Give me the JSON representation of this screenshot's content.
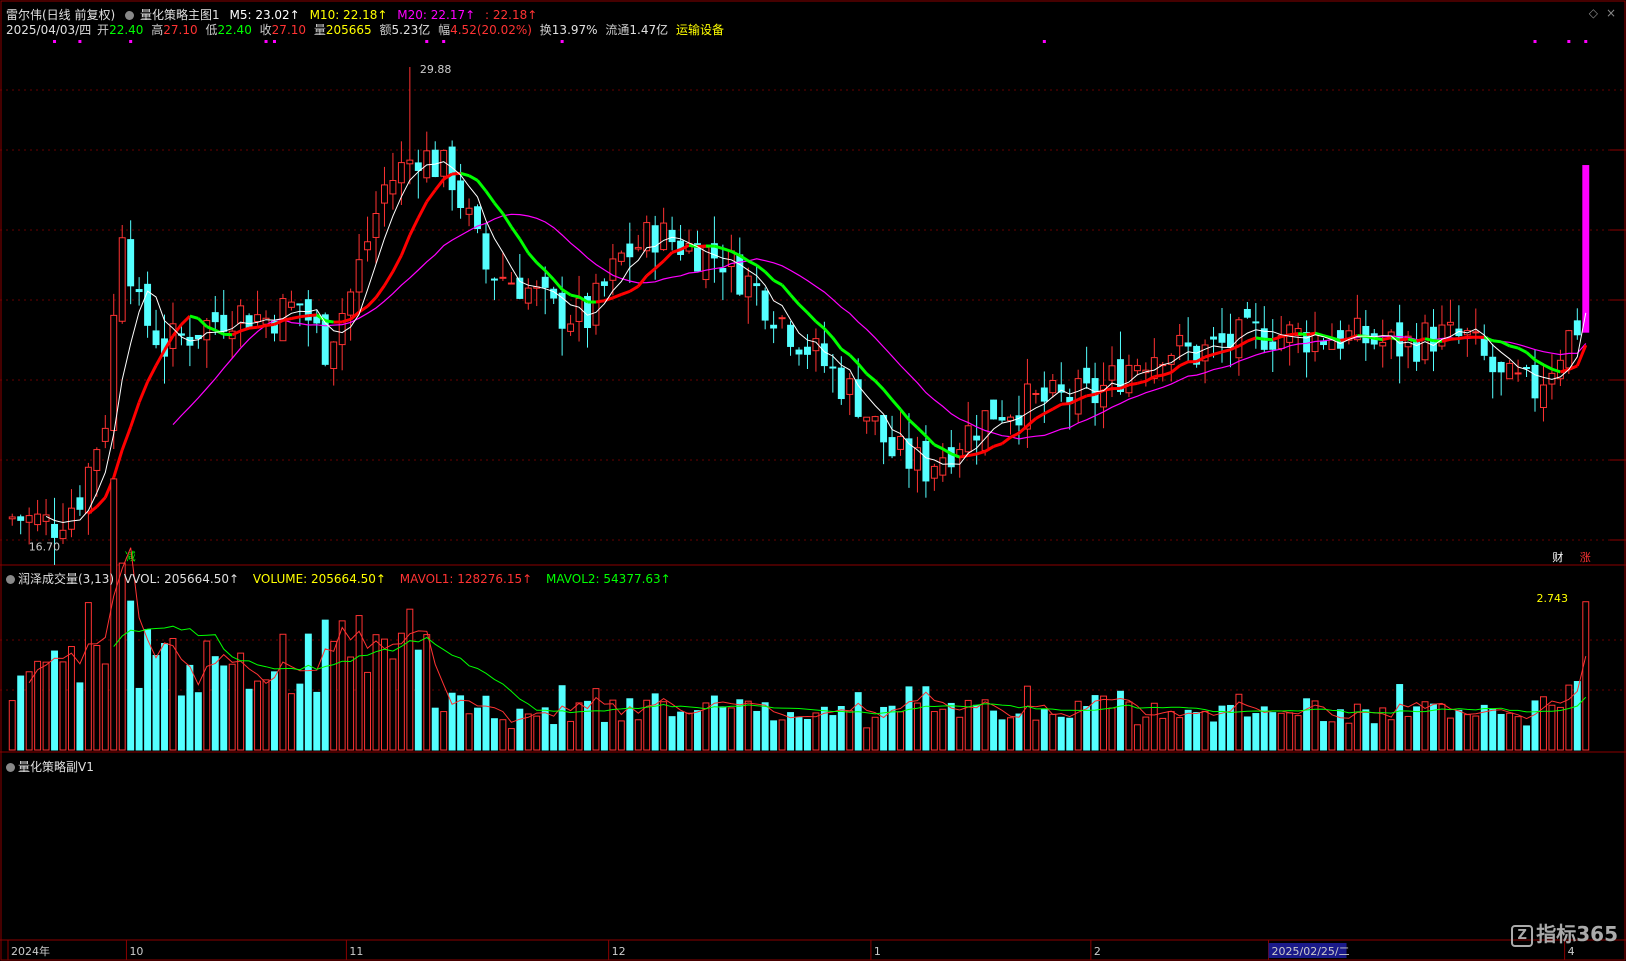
{
  "header": {
    "stock": "雷尔伟(日线 前复权)",
    "indicator_name": "量化策略主图1",
    "m5": "M5: 23.02↑",
    "m10": "M10: 22.18↑",
    "m20": "M20: 22.17↑",
    "extra": ": 22.18↑",
    "date": "2025/04/03/四",
    "open_label": "开",
    "open": "22.40",
    "high_label": "高",
    "high": "27.10",
    "low_label": "低",
    "low": "22.40",
    "close_label": "收",
    "close": "27.10",
    "vol_label": "量",
    "vol": "205665",
    "amount_label": "额",
    "amount": "5.23亿",
    "change_label": "幅",
    "change": "4.52(20.02%)",
    "turnover_label": "换",
    "turnover": "13.97%",
    "float_label": "流通",
    "float": "1.47亿",
    "sector": "运输设备"
  },
  "volume_panel": {
    "name": "润泽成交量(3,13)",
    "vvol": "VVOL: 205664.50↑",
    "volume": "VOLUME: 205664.50↑",
    "mavol1": "MAVOL1: 128276.15↑",
    "mavol2": "MAVOL2: 54377.63↑",
    "max_label": "2.743"
  },
  "sub_panel": {
    "name": "量化策略副V1"
  },
  "markers": {
    "low_price": "16.70",
    "high_price": "29.88",
    "sell": "减",
    "fin": "财",
    "up": "涨"
  },
  "x_axis": {
    "labels": [
      {
        "text": "2024年",
        "index": 0
      },
      {
        "text": "10",
        "index": 14
      },
      {
        "text": "11",
        "index": 40
      },
      {
        "text": "12",
        "index": 71
      },
      {
        "text": "1",
        "index": 102
      },
      {
        "text": "2",
        "index": 128
      },
      {
        "text": "2025/02/25/二",
        "index": 149
      },
      {
        "text": "4",
        "index": 184
      }
    ]
  },
  "logo": {
    "text": "指标365",
    "icon": "z-logo-icon"
  },
  "colors": {
    "up": "#ff3232",
    "down": "#54ffff",
    "ma5": "#ffffff",
    "ma10_up": "#ff0000",
    "ma10_down": "#00ff00",
    "ma20": "#ff00ff",
    "grid": "#8b0000",
    "magenta": "#ff00ff",
    "vol_ma1": "#ff3333",
    "vol_ma2": "#00ff00"
  },
  "chart_data": {
    "type": "candlestick",
    "price_range": [
      16.2,
      30.5
    ],
    "ohlc_seed": "generated series approximating visible trend",
    "key_prices": {
      "min": 16.7,
      "max": 29.88,
      "last_close": 27.1
    },
    "bars": 187
  }
}
